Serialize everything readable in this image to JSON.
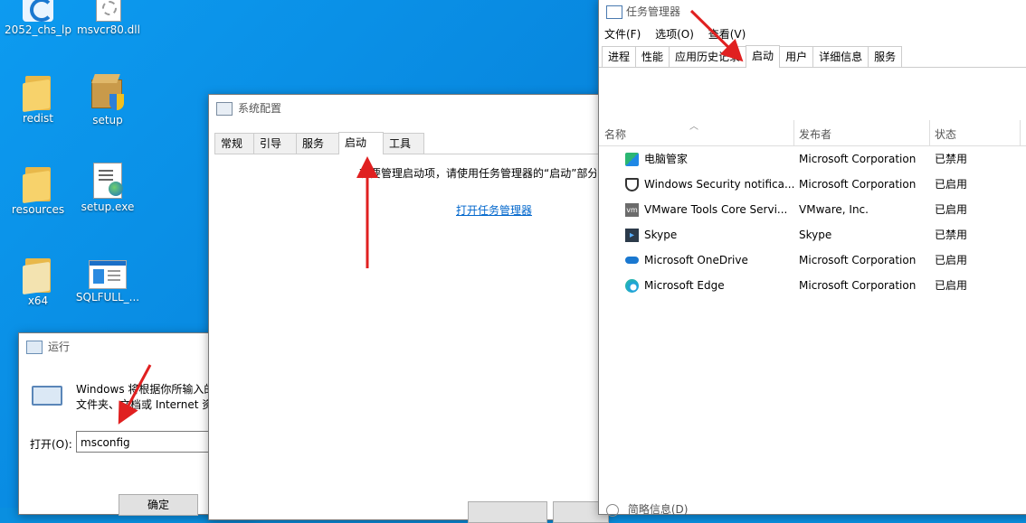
{
  "desktop": {
    "icons": [
      {
        "label": "2052_chs_lp",
        "icon": "app-icon"
      },
      {
        "label": "msvcr80.dll",
        "icon": "dll-file-icon"
      },
      {
        "label": "redist",
        "icon": "folder-icon"
      },
      {
        "label": "setup",
        "icon": "setup-installer-icon"
      },
      {
        "label": "resources",
        "icon": "folder-icon"
      },
      {
        "label": "setup.exe",
        "icon": "exe-file-icon"
      },
      {
        "label": "x64",
        "icon": "folder-icon"
      },
      {
        "label": "SQLFULL_...",
        "icon": "app-window-icon"
      }
    ]
  },
  "run_dialog": {
    "title": "运行",
    "desc_line1": "Windows 将根据你所输入的",
    "desc_line2": "文件夹、文档或 Internet 资",
    "open_label": "打开(O):",
    "input_value": "msconfig",
    "ok_button": "确定"
  },
  "msconfig": {
    "title": "系统配置",
    "tabs": [
      "常规",
      "引导",
      "服务",
      "启动",
      "工具"
    ],
    "active_tab": "启动",
    "message": "若要管理启动项，请使用任务管理器的“启动”部分",
    "link": "打开任务管理器"
  },
  "taskmgr": {
    "title": "任务管理器",
    "menu": [
      "文件(F)",
      "选项(O)",
      "查看(V)"
    ],
    "tabs": [
      "进程",
      "性能",
      "应用历史记录",
      "启动",
      "用户",
      "详细信息",
      "服务"
    ],
    "active_tab": "启动",
    "columns": {
      "name": "名称",
      "publisher": "发布者",
      "status": "状态"
    },
    "rows": [
      {
        "name": "电脑管家",
        "publisher": "Microsoft Corporation",
        "status": "已禁用",
        "icon": "pc-manager-icon"
      },
      {
        "name": "Windows Security notifica...",
        "publisher": "Microsoft Corporation",
        "status": "已启用",
        "icon": "shield-icon"
      },
      {
        "name": "VMware Tools Core Servi...",
        "publisher": "VMware, Inc.",
        "status": "已启用",
        "icon": "vmware-icon"
      },
      {
        "name": "Skype",
        "publisher": "Skype",
        "status": "已禁用",
        "icon": "skype-icon"
      },
      {
        "name": "Microsoft OneDrive",
        "publisher": "Microsoft Corporation",
        "status": "已启用",
        "icon": "onedrive-icon"
      },
      {
        "name": "Microsoft Edge",
        "publisher": "Microsoft Corporation",
        "status": "已启用",
        "icon": "edge-icon"
      }
    ],
    "footer": "简略信息(D)"
  },
  "colors": {
    "desktop": "#0a8fe0",
    "arrow": "#e02020",
    "link": "#0066cc"
  }
}
